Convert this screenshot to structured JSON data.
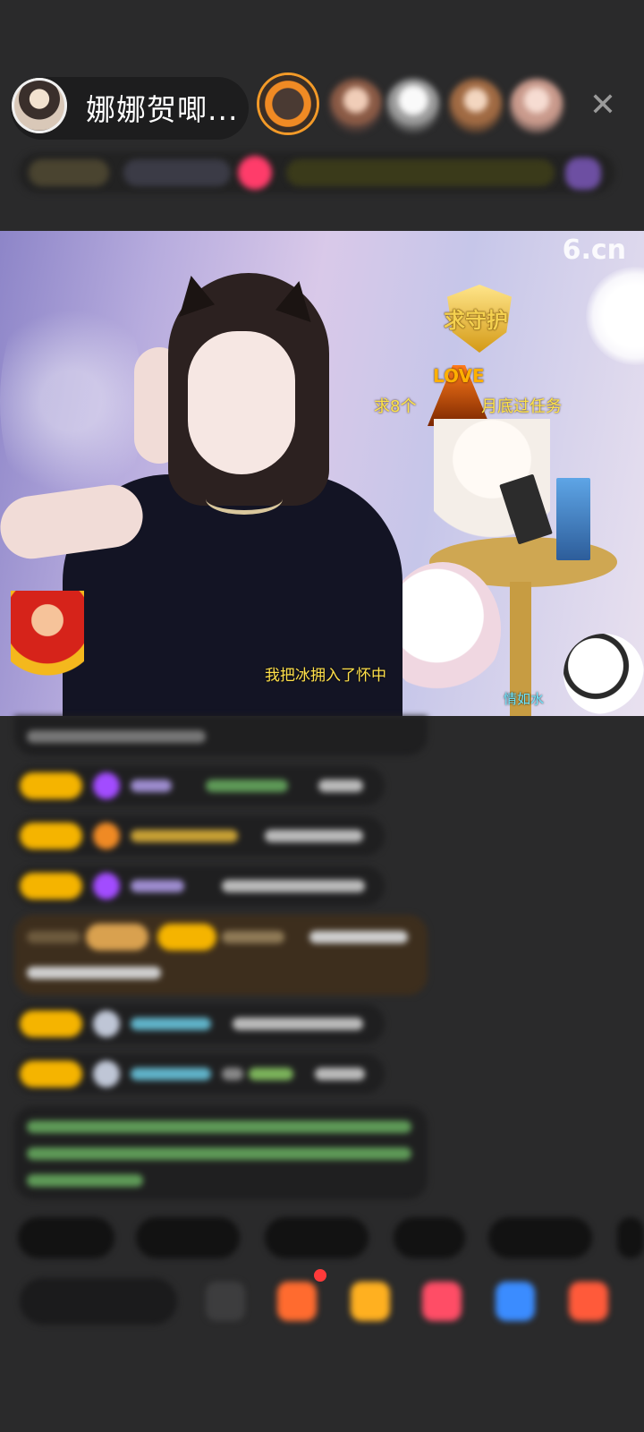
{
  "header": {
    "anchor_name": "娜娜贺唧...",
    "viewers": [
      {
        "color": "#f08a24"
      },
      {
        "color": "#c97c6a"
      },
      {
        "color": "#d9d9d9"
      },
      {
        "color": "#b47a4a"
      },
      {
        "color": "#e7c8c0"
      }
    ],
    "close_label": "✕"
  },
  "video": {
    "logo": "6.cn",
    "shield_label": "求守护",
    "sticker_left": "求8个",
    "sticker_right": "月底过任务",
    "love_label": "LOVE",
    "caption": "我把冰拥入了怀中",
    "corner_tag": "情如水"
  },
  "colors": {
    "badge_gold": "#f5b400",
    "gem_purple": "#a24cff",
    "chat_bg": "#1f1f20",
    "highlight_bg": "#3d2e1d"
  },
  "footer": {
    "quick_replies": 6,
    "tools": [
      "picture-icon",
      "gift-box-icon",
      "red-packet-icon",
      "heart-gift-icon",
      "blue-gift-icon",
      "gift-icon"
    ]
  }
}
